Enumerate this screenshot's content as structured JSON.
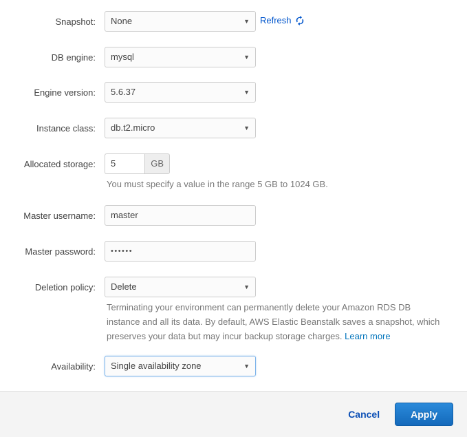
{
  "form": {
    "rows": [
      {
        "id": "snapshot",
        "label": "Snapshot:",
        "type": "select",
        "value": "None",
        "caret": "▼"
      },
      {
        "id": "db-engine",
        "label": "DB engine:",
        "type": "select",
        "value": "mysql",
        "caret": "▼"
      },
      {
        "id": "engine-version",
        "label": "Engine version:",
        "type": "select",
        "value": "5.6.37",
        "caret": "▼"
      },
      {
        "id": "instance-class",
        "label": "Instance class:",
        "type": "select",
        "value": "db.t2.micro",
        "caret": "▼"
      },
      {
        "id": "allocated-storage",
        "label": "Allocated storage:",
        "type": "input-group",
        "value": "5",
        "addon": "GB",
        "help": "You must specify a value in the range 5 GB to 1024 GB."
      },
      {
        "id": "master-username",
        "label": "Master username:",
        "type": "text",
        "value": "master"
      },
      {
        "id": "master-password",
        "label": "Master password:",
        "type": "password",
        "value": "••••••"
      },
      {
        "id": "deletion-policy",
        "label": "Deletion policy:",
        "type": "select",
        "value": "Delete",
        "caret": "▼",
        "help": "Terminating your environment can permanently delete your Amazon RDS DB instance and all its data. By default, AWS Elastic Beanstalk saves a snapshot, which preserves your data but may incur backup storage charges.",
        "help_link": "Learn more"
      },
      {
        "id": "availability",
        "label": "Availability:",
        "type": "select",
        "value": "Single availability zone",
        "caret": "▼",
        "focused": true
      }
    ]
  },
  "refresh": {
    "label": "Refresh",
    "icon": "refresh-icon"
  },
  "footer": {
    "cancel_label": "Cancel",
    "apply_label": "Apply"
  },
  "colors": {
    "link": "#0073bb",
    "refresh_link": "#0055cc",
    "cancel_link": "#0a4eb5",
    "apply_bg_top": "#2a8ada",
    "apply_bg_bottom": "#1469bb",
    "field_bg": "#fbfbfb",
    "field_border": "#cccccc",
    "focus_border": "#7eb4ea",
    "footer_bg": "#f4f4f4",
    "help_text": "#777777",
    "label_text": "#444444"
  }
}
